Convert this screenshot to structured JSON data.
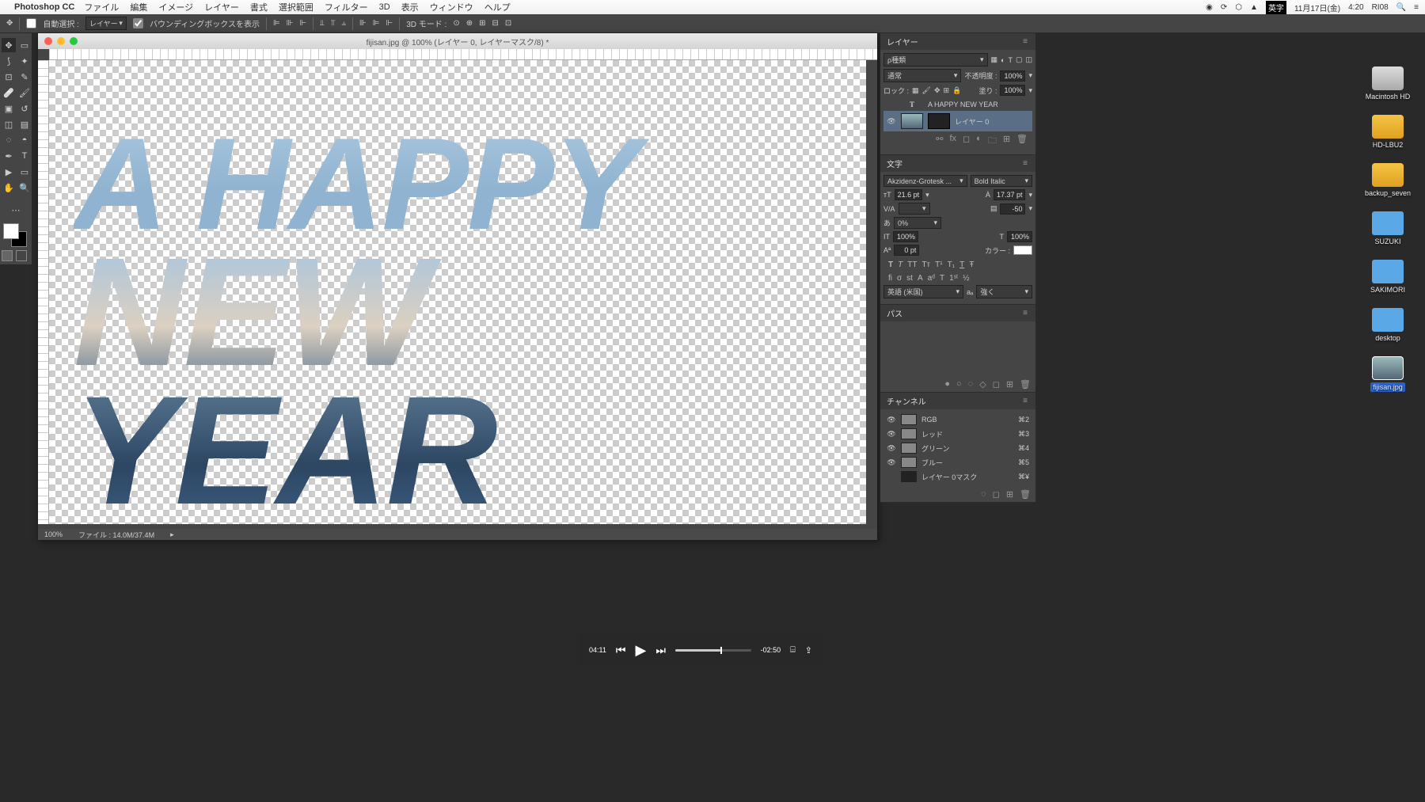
{
  "menubar": {
    "app": "Photoshop CC",
    "items": [
      "ファイル",
      "編集",
      "イメージ",
      "レイヤー",
      "書式",
      "選択範囲",
      "フィルター",
      "3D",
      "表示",
      "ウィンドウ",
      "ヘルプ"
    ],
    "status_lang": "英字",
    "status_date": "11月17日(金)",
    "status_time": "4:20",
    "status_user": "RI08"
  },
  "optionbar": {
    "auto_select": "自動選択 :",
    "auto_select_mode": "レイヤー",
    "show_bbox": "バウンディングボックスを表示",
    "mode_3d": "3D モード :"
  },
  "document": {
    "title": "fijisan.jpg @ 100% (レイヤー 0, レイヤーマスク/8) *",
    "zoom": "100%",
    "filesize": "ファイル : 14.0M/37.4M",
    "art_line1": "A HAPPY",
    "art_line2": "NEW YEAR"
  },
  "layers_panel": {
    "title": "レイヤー",
    "filter_label": "種類",
    "blend_mode": "通常",
    "opacity_label": "不透明度 :",
    "opacity": "100%",
    "lock_label": "ロック :",
    "fill_label": "塗り :",
    "fill": "100%",
    "layers": [
      {
        "name": "A HAPPY NEW YEAR",
        "type": "text"
      },
      {
        "name": "レイヤー 0",
        "type": "image",
        "selected": true
      }
    ]
  },
  "character_panel": {
    "title": "文字",
    "font_family": "Akzidenz-Grotesk ...",
    "font_style": "Bold Italic",
    "size": "21.6 pt",
    "leading": "17.37 pt",
    "tracking": "-50",
    "kerning": "0%",
    "vscale": "100%",
    "hscale": "100%",
    "baseline": "0 pt",
    "color_label": "カラー :",
    "language": "英語 (米国)",
    "aa": "強く"
  },
  "paths_panel": {
    "title": "パス"
  },
  "channels_panel": {
    "title": "チャンネル",
    "items": [
      {
        "name": "RGB",
        "shortcut": "⌘2"
      },
      {
        "name": "レッド",
        "shortcut": "⌘3"
      },
      {
        "name": "グリーン",
        "shortcut": "⌘4"
      },
      {
        "name": "ブルー",
        "shortcut": "⌘5"
      },
      {
        "name": "レイヤー 0マスク",
        "shortcut": "⌘¥"
      }
    ]
  },
  "desktop": {
    "items": [
      {
        "name": "Macintosh HD",
        "kind": "hd"
      },
      {
        "name": "HD-LBU2",
        "kind": "drive"
      },
      {
        "name": "backup_seven",
        "kind": "drive"
      },
      {
        "name": "SUZUKI",
        "kind": "folder"
      },
      {
        "name": "SAKIMORI",
        "kind": "folder"
      },
      {
        "name": "desktop",
        "kind": "folder"
      },
      {
        "name": "fijisan.jpg",
        "kind": "file",
        "selected": true
      }
    ]
  },
  "player": {
    "elapsed": "04:11",
    "remaining": "-02:50"
  }
}
